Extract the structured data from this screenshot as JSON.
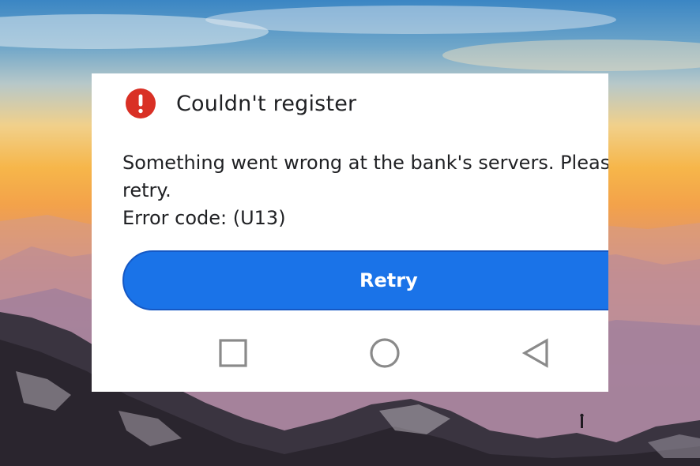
{
  "dialog": {
    "icon": "error-exclamation-icon",
    "title": "Couldn't register",
    "message_line1": "Something went wrong at the bank's servers. Please",
    "message_line2": "retry.",
    "error_code": "Error code: (U13)",
    "retry_label": "Retry"
  },
  "navbar": {
    "recents_icon": "square-icon",
    "home_icon": "circle-icon",
    "back_icon": "triangle-back-icon"
  },
  "colors": {
    "error_red": "#d93025",
    "button_blue": "#1a73e8",
    "nav_gray": "#8a8a8a",
    "text": "#202124"
  }
}
